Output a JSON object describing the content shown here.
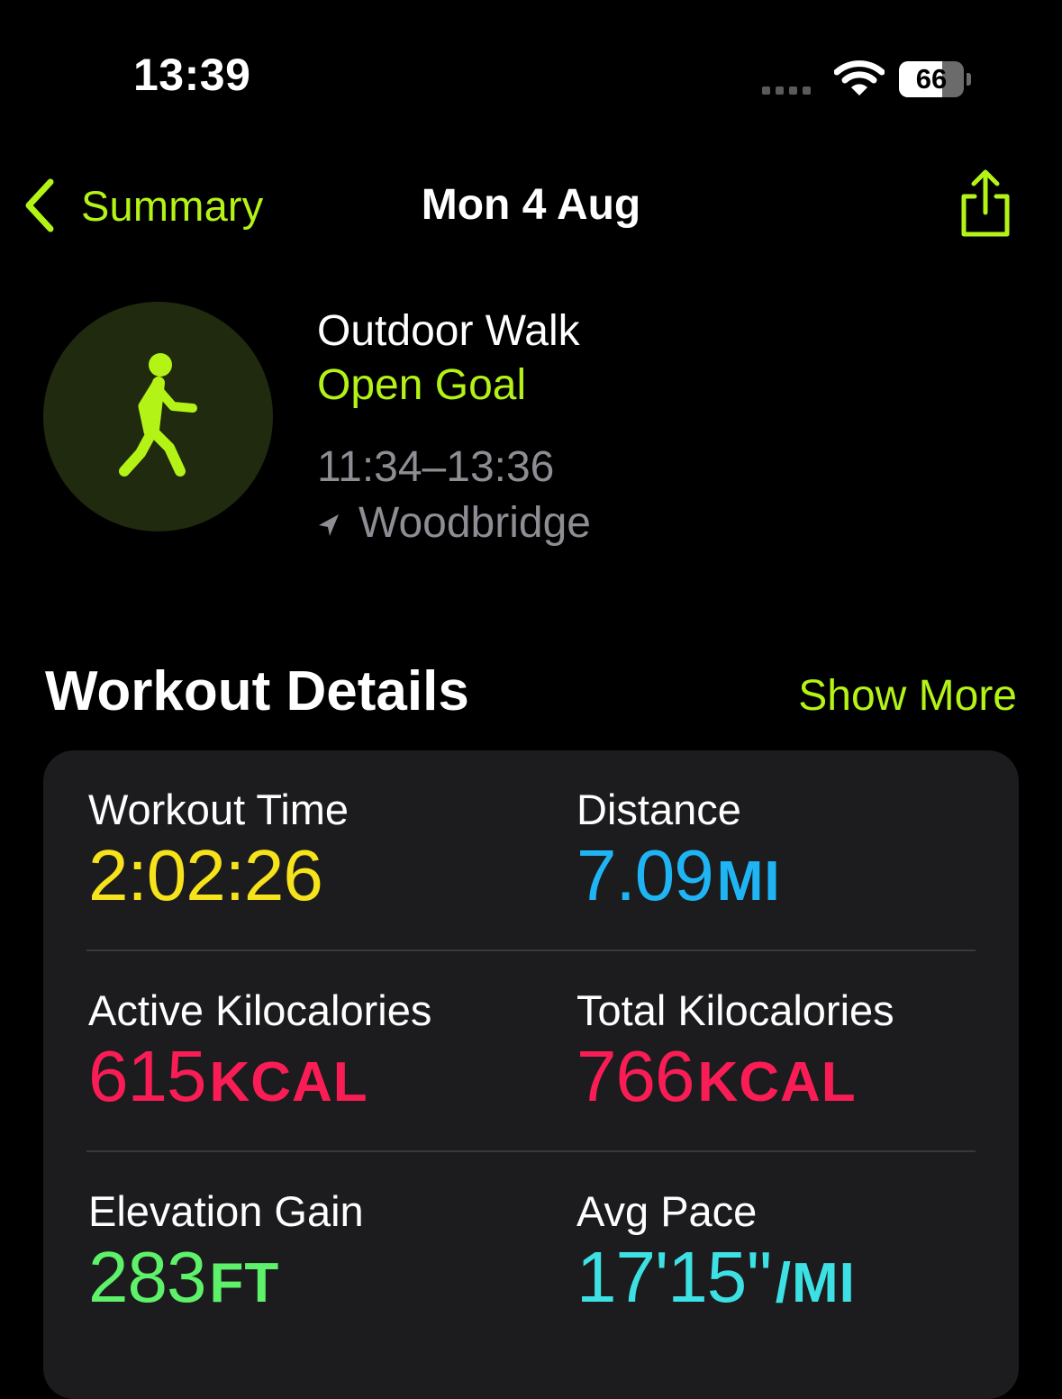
{
  "status_bar": {
    "time": "13:39",
    "battery_percent": "66",
    "battery_level": 0.66
  },
  "nav": {
    "back_label": "Summary",
    "title": "Mon 4 Aug"
  },
  "workout": {
    "name": "Outdoor Walk",
    "goal": "Open Goal",
    "time_range": "11:34–13:36",
    "location": "Woodbridge",
    "icon": "figure-walk-icon"
  },
  "details": {
    "title": "Workout Details",
    "show_more": "Show More",
    "metrics": [
      {
        "label": "Workout Time",
        "value": "2:02:26",
        "unit": "",
        "color": "#f6e31b"
      },
      {
        "label": "Distance",
        "value": "7.09",
        "unit": "MI",
        "color": "#1fb5f5"
      },
      {
        "label": "Active Kilocalories",
        "value": "615",
        "unit": "KCAL",
        "color": "#fa1d55"
      },
      {
        "label": "Total Kilocalories",
        "value": "766",
        "unit": "KCAL",
        "color": "#fa1d55"
      },
      {
        "label": "Elevation Gain",
        "value": "283",
        "unit": "FT",
        "color": "#5ef16a"
      },
      {
        "label": "Avg Pace",
        "value": "17'15''",
        "unit": "/MI",
        "color": "#3de0e3"
      }
    ]
  },
  "colors": {
    "accent": "#b4f316",
    "secondary_text": "#8d8d93",
    "card_bg": "#1c1c1e"
  }
}
